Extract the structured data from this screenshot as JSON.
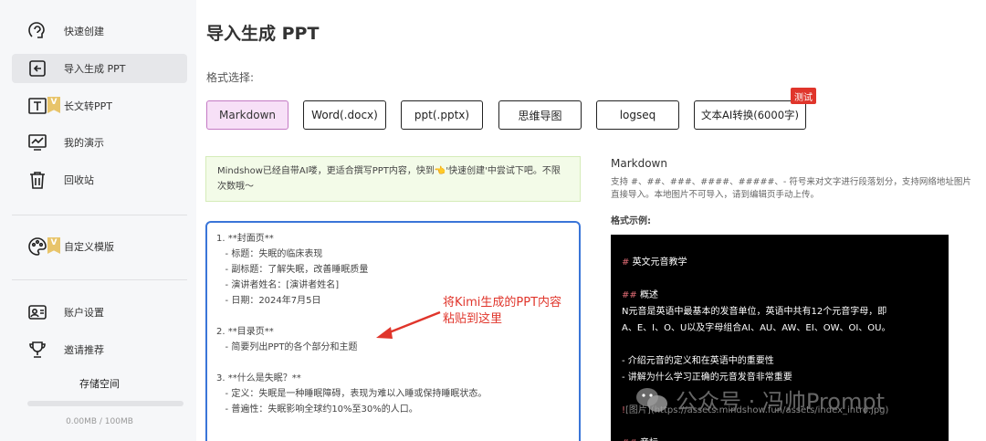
{
  "sidebar": {
    "items": [
      {
        "label": "快速创建",
        "icon": "brain-icon"
      },
      {
        "label": "导入生成 PPT",
        "icon": "import-icon",
        "active": true
      },
      {
        "label": "长文转PPT",
        "icon": "text-icon",
        "badge": "V"
      },
      {
        "label": "我的演示",
        "icon": "presentation-icon"
      },
      {
        "label": "回收站",
        "icon": "trash-icon"
      },
      {
        "label": "自定义模版",
        "icon": "palette-icon",
        "badge": "V"
      },
      {
        "label": "账户设置",
        "icon": "account-icon"
      },
      {
        "label": "邀请推荐",
        "icon": "trophy-icon"
      }
    ],
    "storage": {
      "title": "存储空间",
      "used_text": "0.00MB / 100MB",
      "fraction": 0
    }
  },
  "main": {
    "title": "导入生成 PPT",
    "format_label": "格式选择:",
    "formats": [
      {
        "label": "Markdown",
        "selected": true
      },
      {
        "label": "Word(.docx)"
      },
      {
        "label": "ppt(.pptx)"
      },
      {
        "label": "思维导图"
      },
      {
        "label": "logseq"
      },
      {
        "label": "文本AI转换(6000字)"
      }
    ],
    "test_badge": "测试",
    "notice": "Mindshow已经自带AI喽，更适合撰写PPT内容，快到👈'快速创建'中尝试下吧。不限次数哦～",
    "editor_text": "1. **封面页**\n   - 标题：失眠的临床表现\n   - 副标题：了解失眠，改善睡眠质量\n   - 演讲者姓名：[演讲者姓名]\n   - 日期：2024年7月5日\n\n2. **目录页**\n   - 简要列出PPT的各个部分和主题\n\n3. **什么是失眠？**\n   - 定义：失眠是一种睡眠障碍，表现为难以入睡或保持睡眠状态。\n   - 普遍性：失眠影响全球约10%至30%的人口。",
    "annotation": "将Kimi生成的PPT内容\n粘贴到这里"
  },
  "help": {
    "title": "Markdown",
    "description": "支持 #、##、###、####、#####、- 符号来对文字进行段落划分，支持网络地址图片直接导入。本地图片不可导入，请到编辑页手动上传。",
    "example_label": "格式示例:",
    "example_lines": [
      {
        "hash": "# ",
        "text": "英文元音教学"
      },
      {
        "hash": "",
        "text": ""
      },
      {
        "hash": "## ",
        "text": "概述"
      },
      {
        "hash": "",
        "text": "N元音是英语中最基本的发音单位，英语中共有12个元音字母，即"
      },
      {
        "hash": "",
        "text": "A、E、I、O、U以及字母组合AI、AU、AW、EI、OW、OI、OU。"
      },
      {
        "hash": "",
        "text": ""
      },
      {
        "hash": "",
        "text": "- 介绍元音的定义和在英语中的重要性"
      },
      {
        "hash": "",
        "text": "- 讲解为什么学习正确的元音发音非常重要"
      },
      {
        "hash": "",
        "text": ""
      },
      {
        "hash": "!",
        "text": "[图片](https://assets.mindshow.fun/assets/index_intro.jpg)"
      },
      {
        "hash": "",
        "text": ""
      },
      {
        "hash": "## ",
        "text": "音标"
      }
    ]
  },
  "watermark": "公众号 · 冯帅Prompt"
}
